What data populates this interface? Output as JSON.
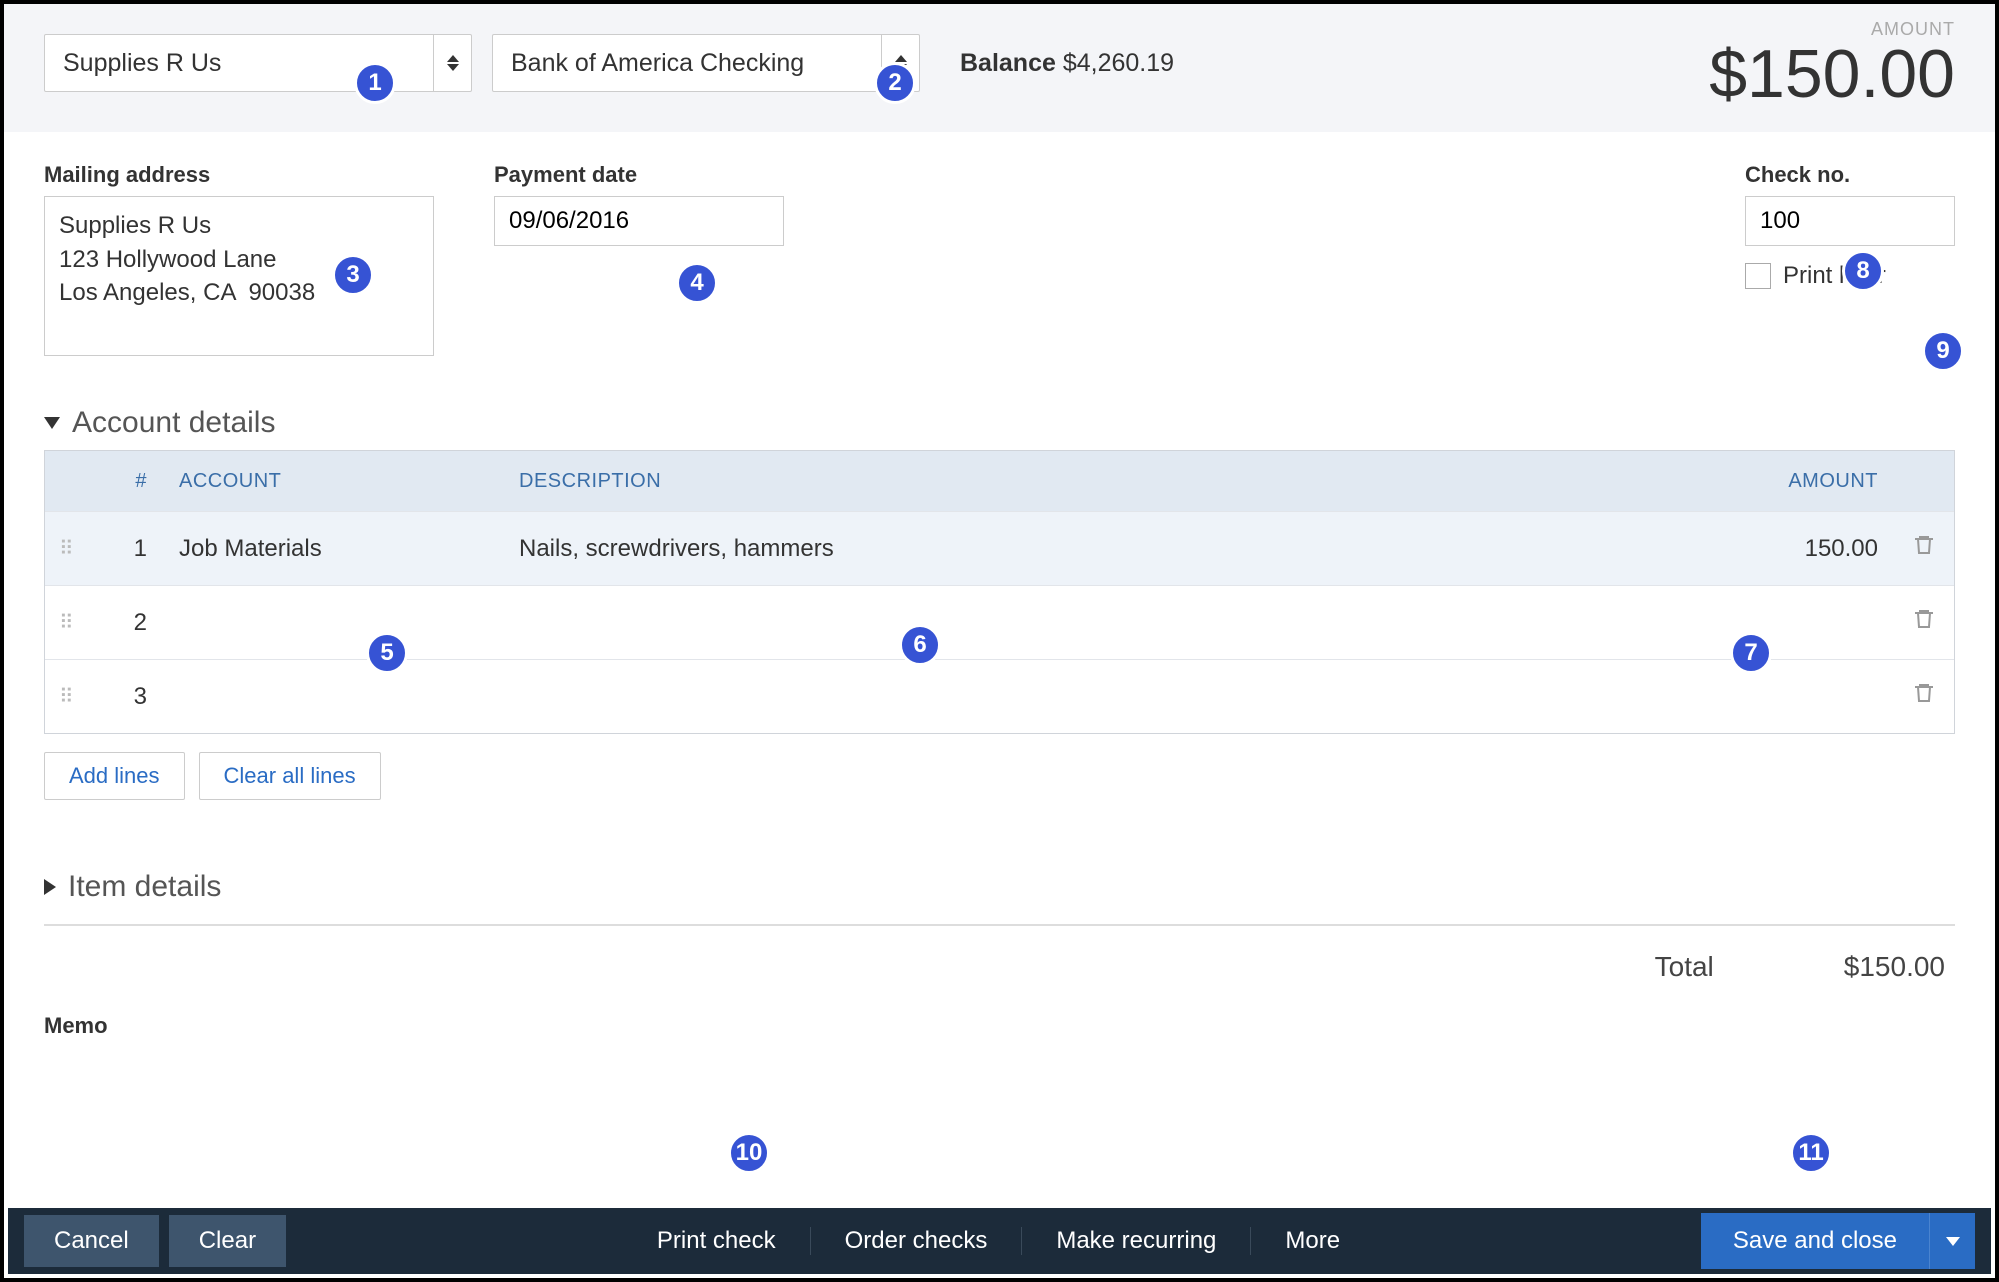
{
  "header": {
    "payee": "Supplies R Us",
    "bank_account": "Bank of America Checking",
    "balance_label": "Balance",
    "balance_value": "$4,260.19",
    "amount_label": "AMOUNT",
    "amount_value": "$150.00"
  },
  "fields": {
    "mailing_label": "Mailing address",
    "mailing_value": "Supplies R Us\n123 Hollywood Lane\nLos Angeles, CA  90038",
    "payment_date_label": "Payment date",
    "payment_date_value": "09/06/2016",
    "check_no_label": "Check no.",
    "check_no_value": "100",
    "print_later_label": "Print later"
  },
  "sections": {
    "account_details": "Account details",
    "item_details": "Item details"
  },
  "table": {
    "columns": {
      "num": "#",
      "account": "ACCOUNT",
      "description": "DESCRIPTION",
      "amount": "AMOUNT"
    },
    "rows": [
      {
        "num": "1",
        "account": "Job Materials",
        "description": "Nails, screwdrivers, hammers",
        "amount": "150.00"
      },
      {
        "num": "2",
        "account": "",
        "description": "",
        "amount": ""
      },
      {
        "num": "3",
        "account": "",
        "description": "",
        "amount": ""
      }
    ],
    "add_lines": "Add lines",
    "clear_lines": "Clear all lines"
  },
  "totals": {
    "label": "Total",
    "value": "$150.00"
  },
  "memo_label": "Memo",
  "footer": {
    "cancel": "Cancel",
    "clear": "Clear",
    "print_check": "Print check",
    "order_checks": "Order checks",
    "make_recurring": "Make recurring",
    "more": "More",
    "save": "Save and close"
  },
  "badges": {
    "1": "1",
    "2": "2",
    "3": "3",
    "4": "4",
    "5": "5",
    "6": "6",
    "7": "7",
    "8": "8",
    "9": "9",
    "10": "10",
    "11": "11"
  }
}
